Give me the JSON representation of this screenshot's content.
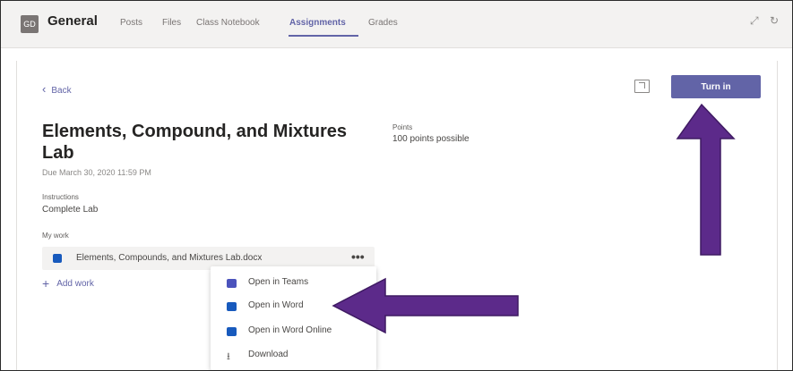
{
  "header": {
    "team_initials": "GD",
    "team_name": "General",
    "tabs": [
      {
        "label": "Posts"
      },
      {
        "label": "Files"
      },
      {
        "label": "Class Notebook"
      },
      {
        "label": "Assignments"
      },
      {
        "label": "Grades"
      }
    ],
    "active_tab": "Assignments"
  },
  "assignment": {
    "back_label": "Back",
    "turn_in_label": "Turn in",
    "title": "Elements, Compound, and Mixtures Lab",
    "due": "Due March 30, 2020 11:59 PM",
    "points_label": "Points",
    "points_value": "100 points possible",
    "instructions_label": "Instructions",
    "instructions_value": "Complete Lab",
    "my_work_label": "My work",
    "file_name": "Elements, Compounds, and Mixtures Lab.docx",
    "add_work_label": "Add work"
  },
  "context_menu": {
    "items": [
      {
        "label": "Open in Teams",
        "icon": "teams-icon"
      },
      {
        "label": "Open in Word",
        "icon": "word-icon"
      },
      {
        "label": "Open in Word Online",
        "icon": "word-online-icon"
      },
      {
        "label": "Download",
        "icon": "download-icon"
      }
    ]
  },
  "colors": {
    "accent": "#6264a7",
    "annotation_arrow": "#5c2a8a",
    "word_blue": "#185abd"
  }
}
